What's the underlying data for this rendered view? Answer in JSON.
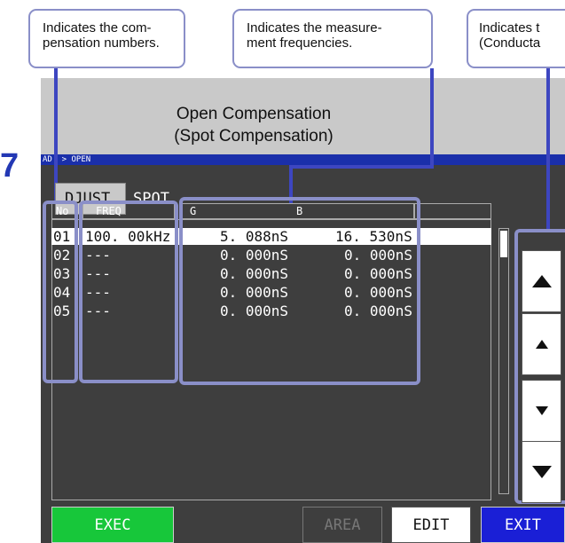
{
  "callouts": {
    "comp_numbers": [
      "Indicates the com-",
      "pensation numbers."
    ],
    "frequencies": [
      "Indicates the measure-",
      "ment frequencies."
    ],
    "values": [
      "Indicates t",
      "(Conducta"
    ]
  },
  "step_number": "7",
  "screen": {
    "title_line1": "Open Compensation",
    "title_line2": "(Spot Compensation)",
    "breadcrumb": "AD  > OPEN",
    "tab_adjust": "DJUST",
    "tab_spot": "SPOT",
    "columns": {
      "no": "No",
      "freq": "FREQ",
      "g": "G",
      "b": "B"
    },
    "rows": [
      {
        "no": "01",
        "freq": "100. 00kHz",
        "g": "5. 088nS",
        "b": "16. 530nS"
      },
      {
        "no": "02",
        "freq": "---",
        "g": "0. 000nS",
        "b": "0. 000nS"
      },
      {
        "no": "03",
        "freq": "---",
        "g": "0. 000nS",
        "b": "0. 000nS"
      },
      {
        "no": "04",
        "freq": "---",
        "g": "0. 000nS",
        "b": "0. 000nS"
      },
      {
        "no": "05",
        "freq": "---",
        "g": "0. 000nS",
        "b": "0. 000nS"
      }
    ],
    "selected_row": 1,
    "buttons": {
      "exec": "EXEC",
      "area": "AREA",
      "edit": "EDIT",
      "exit": "EXIT"
    },
    "scroll_buttons": [
      "page-up-icon",
      "line-up-icon",
      "line-down-icon",
      "page-down-icon"
    ]
  },
  "colors": {
    "accent_blue": "#2338b4",
    "callout_border": "#8a8fc8",
    "exec_green": "#17c73a",
    "exit_blue": "#1a1fd6"
  }
}
